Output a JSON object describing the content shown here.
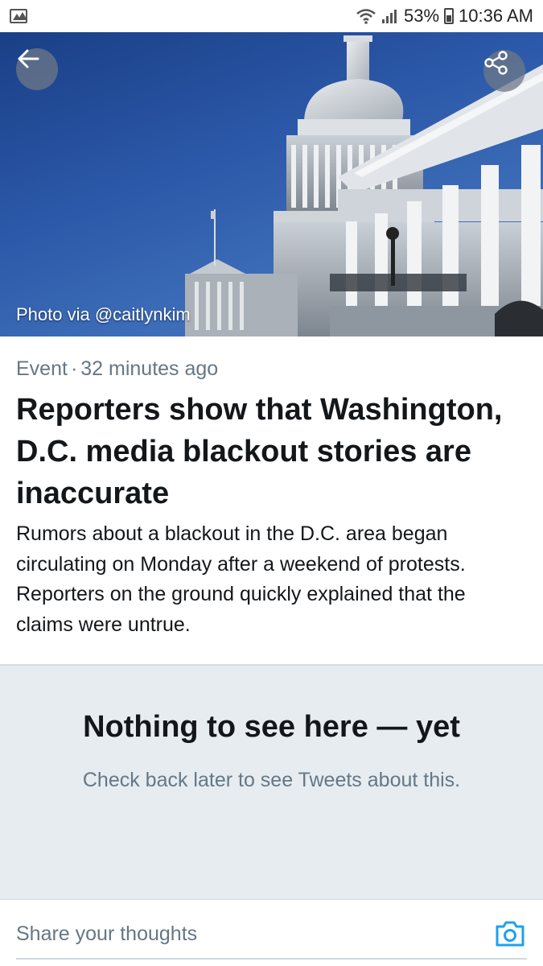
{
  "status_bar": {
    "battery": "53%",
    "time": "10:36 AM",
    "icons": [
      "gallery-icon",
      "wifi-icon",
      "signal-icon",
      "battery-icon"
    ]
  },
  "hero": {
    "photo_credit": "Photo via @caitlynkim",
    "back_icon": "arrow-left-icon",
    "share_icon": "share-icon"
  },
  "article": {
    "category": "Event",
    "separator": "·",
    "time_ago": "32 minutes ago",
    "headline": "Reporters show that Washington, D.C. media blackout stories are inaccurate",
    "summary": "Rumors about a blackout in the D.C. area began circulating on Monday after a weekend of protests. Reporters on the ground quickly explained that the claims were untrue."
  },
  "empty_state": {
    "title": "Nothing to see here — yet",
    "subtitle": "Check back later to see Tweets about this."
  },
  "composer": {
    "placeholder": "Share your thoughts",
    "camera_icon": "camera-icon"
  },
  "colors": {
    "accent": "#1da1f2",
    "secondary_text": "#657786",
    "empty_bg": "#e6ecf0"
  }
}
